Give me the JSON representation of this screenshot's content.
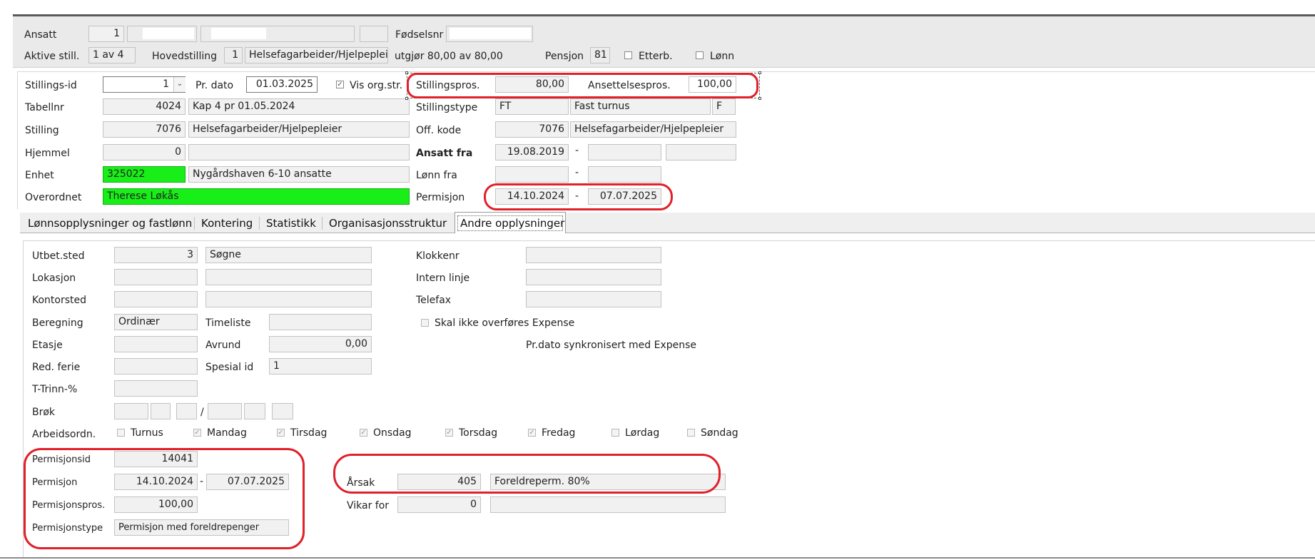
{
  "header": {
    "ansatt_label": "Ansatt",
    "ansatt_nr": "1",
    "fodselsnr_label": "Fødselsnr",
    "aktive_still_label": "Aktive still.",
    "aktive_still_value": "1 av 4",
    "hovedstilling_label": "Hovedstilling",
    "hovedstilling_nr": "1",
    "hovedstilling_name": "Helsefagarbeider/Hjelpepleier",
    "utgjor_text": "utgjør 80,00 av 80,00",
    "pensjon_label": "Pensjon",
    "pensjon_value": "81",
    "etterb_label": "Etterb.",
    "lonn_label": "Lønn"
  },
  "position": {
    "stillings_id_label": "Stillings-id",
    "stillings_id_value": "1",
    "pr_dato_label": "Pr. dato",
    "pr_dato_value": "01.03.2025",
    "vis_org_label": "Vis org.str.",
    "stillingspros_label": "Stillingspros.",
    "stillingspros_value": "80,00",
    "ansettelsespros_label": "Ansettelsespros.",
    "ansettelsespros_value": "100,00",
    "tabellnr_label": "Tabellnr",
    "tabellnr_value": "4024",
    "tabellnr_desc": "Kap 4 pr 01.05.2024",
    "stillingstype_label": "Stillingstype",
    "stillingstype_code": "FT",
    "stillingstype_desc": "Fast turnus",
    "stillingstype_flag": "F",
    "stilling_label": "Stilling",
    "stilling_value": "7076",
    "stilling_desc": "Helsefagarbeider/Hjelpepleier",
    "off_kode_label": "Off. kode",
    "off_kode_value": "7076",
    "off_kode_desc": "Helsefagarbeider/Hjelpepleier",
    "hjemmel_label": "Hjemmel",
    "hjemmel_value": "0",
    "ansatt_fra_label": "Ansatt fra",
    "ansatt_fra_value": "19.08.2019",
    "enhet_label": "Enhet",
    "enhet_value": "325022",
    "enhet_desc": "Nygårdshaven 6-10 ansatte",
    "lonn_fra_label": "Lønn fra",
    "overordnet_label": "Overordnet",
    "overordnet_value": "Therese Løkås",
    "permisjon_label": "Permisjon",
    "permisjon_from": "14.10.2024",
    "permisjon_to": "07.07.2025",
    "dash": "-"
  },
  "tabs": [
    {
      "label": "Lønnsopplysninger og fastlønn"
    },
    {
      "label": "Kontering"
    },
    {
      "label": "Statistikk"
    },
    {
      "label": "Organisasjonsstruktur"
    },
    {
      "label": "Andre opplysninger"
    }
  ],
  "other": {
    "utbet_sted_label": "Utbet.sted",
    "utbet_sted_value": "3",
    "utbet_sted_desc": "Søgne",
    "lokasjon_label": "Lokasjon",
    "kontorsted_label": "Kontorsted",
    "beregning_label": "Beregning",
    "beregning_value": "Ordinær",
    "timeliste_label": "Timeliste",
    "etasje_label": "Etasje",
    "avrund_label": "Avrund",
    "avrund_value": "0,00",
    "red_ferie_label": "Red. ferie",
    "spesial_id_label": "Spesial id",
    "spesial_id_value": "1",
    "t_trinn_label": "T-Trinn-%",
    "brok_label": "Brøk",
    "brok_slash": "/",
    "klokkenr_label": "Klokkenr",
    "intern_linje_label": "Intern linje",
    "telefax_label": "Telefax",
    "skal_ikke_label": "Skal ikke overføres Expense",
    "pr_dato_sync_text": "Pr.dato synkronisert med Expense",
    "arbeidsordn_label": "Arbeidsordn.",
    "days": [
      {
        "label": "Turnus",
        "checked": false
      },
      {
        "label": "Mandag",
        "checked": true
      },
      {
        "label": "Tirsdag",
        "checked": true
      },
      {
        "label": "Onsdag",
        "checked": true
      },
      {
        "label": "Torsdag",
        "checked": true
      },
      {
        "label": "Fredag",
        "checked": true
      },
      {
        "label": "Lørdag",
        "checked": false
      },
      {
        "label": "Søndag",
        "checked": false
      }
    ],
    "permisjonsid_label": "Permisjonsid",
    "permisjonsid_value": "14041",
    "permisjon_label": "Permisjon",
    "permisjon_from": "14.10.2024",
    "permisjon_to": "07.07.2025",
    "permisjonspros_label": "Permisjonspros.",
    "permisjonspros_value": "100,00",
    "permisjonstype_label": "Permisjonstype",
    "permisjonstype_value": "Permisjon med foreldrepenger",
    "arsak_label": "Årsak",
    "arsak_value": "405",
    "arsak_desc": "Foreldreperm. 80%",
    "vikar_for_label": "Vikar for",
    "vikar_for_value": "0",
    "dash": "-"
  },
  "colors": {
    "highlight_green": "#18ee18",
    "annotation_red": "#e0202a"
  }
}
